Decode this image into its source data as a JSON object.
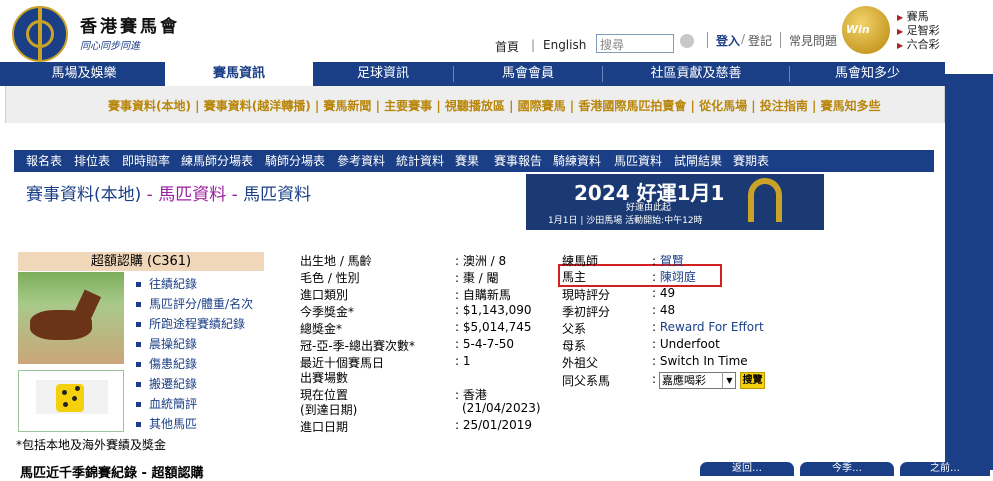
{
  "header": {
    "org_name": "香港賽馬會",
    "slogan": "同心同步同進",
    "links": {
      "home": "首頁",
      "english": "English",
      "search_placeholder": "搜尋",
      "login": "登入",
      "register": "登記",
      "faq": "常見問題"
    },
    "bet_links": [
      "賽馬",
      "足智彩",
      "六合彩"
    ],
    "win_logo_text": "Win"
  },
  "nav": {
    "items": [
      "馬場及娛樂",
      "賽馬資訊",
      "足球資訊",
      "馬會會員",
      "社區貢獻及慈善",
      "馬會知多少"
    ],
    "active_index": 1
  },
  "subnav": {
    "links": "賽事資料(本地) | 賽事資料(越洋轉播) | 賽馬新聞 | 主要賽事 | 視聽播放區 | 國際賽馬 | 香港國際馬匹拍賣會 | 從化馬場 | 投注指南 | 賽馬知多些"
  },
  "tabs": [
    "報名表",
    "排位表",
    "即時賠率",
    "練馬師分場表",
    "騎師分場表",
    "參考資料",
    "統計資料",
    "賽果",
    "賽事報告",
    "騎練資料",
    "馬匹資料",
    "試閘結果",
    "賽期表"
  ],
  "title": {
    "main": "賽事資料(本地)",
    "dash1": "-",
    "crumb1": "馬匹資料",
    "dash2": "-",
    "crumb2": "馬匹資料"
  },
  "banner": {
    "line1": "2024 好運1月1",
    "line2": "好運由此起",
    "line3": "1月1日 | 沙田馬場  活動開始:中午12時"
  },
  "horse": {
    "box_title": "超額認購 (C361)",
    "links": [
      "往績紀錄",
      "馬匹評分/體重/名次",
      "所跑途程賽績紀錄",
      "晨操紀錄",
      "傷患紀錄",
      "搬遷紀錄",
      "血統簡評",
      "其他馬匹"
    ],
    "note": "*包括本地及海外賽績及獎金",
    "info_left": [
      {
        "label": "出生地 / 馬齡",
        "value": "澳洲 / 8"
      },
      {
        "label": "毛色 / 性別",
        "value": "棗 / 閹"
      },
      {
        "label": "進口類別",
        "value": "自購新馬"
      },
      {
        "label": "今季獎金*",
        "value": "$1,143,090"
      },
      {
        "label": "總獎金*",
        "value": "$5,014,745"
      },
      {
        "label": "冠-亞-季-總出賽次數*",
        "value": "5-4-7-50"
      },
      {
        "label": "最近十個賽馬日",
        "value": "1"
      },
      {
        "label": "出賽場數",
        "value": ""
      },
      {
        "label": "現在位置",
        "value": "香港"
      },
      {
        "label": "(到達日期)",
        "value": "(21/04/2023)"
      },
      {
        "label": "進口日期",
        "value": "25/01/2019"
      }
    ],
    "info_right": [
      {
        "label": "練馬師",
        "value": "賀賢",
        "link": true
      },
      {
        "label": "馬主",
        "value": "陳翊庭",
        "link": true
      },
      {
        "label": "現時評分",
        "value": "49",
        "link": false
      },
      {
        "label": "季初評分",
        "value": "48",
        "link": false
      },
      {
        "label": "父系",
        "value": "Reward For Effort",
        "link": true
      },
      {
        "label": "母系",
        "value": "Underfoot",
        "link": false
      },
      {
        "label": "外祖父",
        "value": "Switch In Time",
        "link": false
      },
      {
        "label": "同父系馬",
        "value": "",
        "link": false
      }
    ],
    "sibling_select": "嘉應喝彩",
    "go_button": "搜覽"
  },
  "bottom": {
    "heading": "馬匹近千季錦賽紀錄 - 超額認購",
    "buttons": [
      "返回…",
      "今季…",
      "之前…"
    ]
  }
}
